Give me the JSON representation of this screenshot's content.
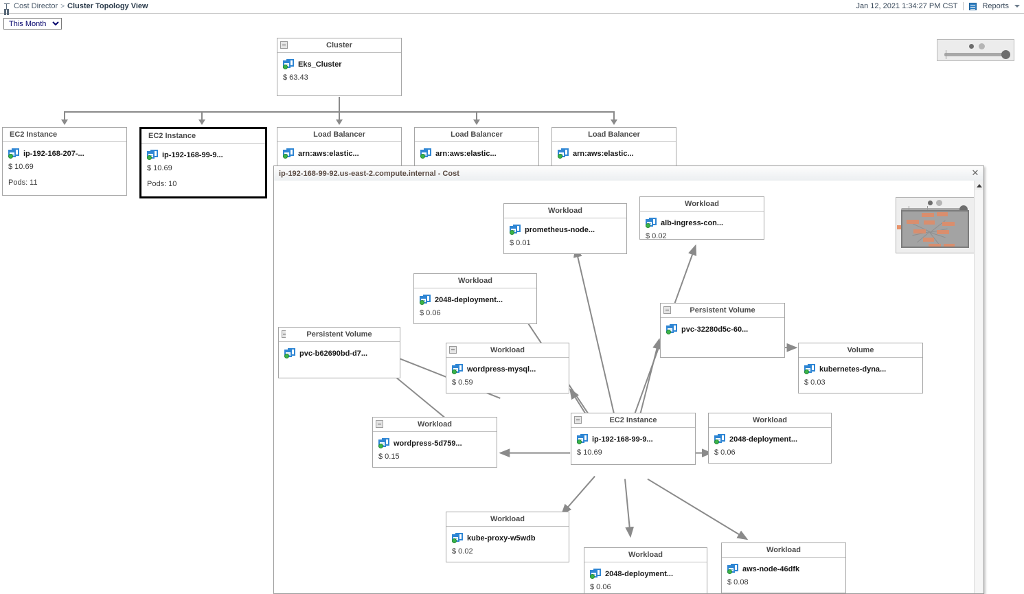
{
  "header": {
    "breadcrumb_root": "Cost Director",
    "breadcrumb_sep": ">",
    "breadcrumb_current": "Cluster Topology View",
    "timestamp": "Jan 12, 2021 1:34:27 PM CST",
    "reports_label": "Reports",
    "home_icon": "home-icon",
    "reports_icon": "reports-icon",
    "caret_icon": "chevron-down-icon"
  },
  "toolbar": {
    "period_selected": "This Month",
    "period_options": [
      "This Month"
    ]
  },
  "canvas": {
    "zoom_widget_name": "zoom-slider"
  },
  "topology": {
    "cluster": {
      "type_label": "Cluster",
      "name": "Eks_Cluster",
      "cost": "$ 63.43"
    },
    "children": [
      {
        "type_label": "EC2 Instance",
        "name": "ip-192-168-207-...",
        "cost": "$ 10.69",
        "pods": "Pods: 11",
        "selected": false,
        "title_align": "left"
      },
      {
        "type_label": "EC2 Instance",
        "name": "ip-192-168-99-9...",
        "cost": "$ 10.69",
        "pods": "Pods: 10",
        "selected": true,
        "title_align": "left"
      },
      {
        "type_label": "Load Balancer",
        "name": "arn:aws:elastic...",
        "cost": "",
        "pods": "",
        "selected": false,
        "title_align": "center"
      },
      {
        "type_label": "Load Balancer",
        "name": "arn:aws:elastic...",
        "cost": "",
        "pods": "",
        "selected": false,
        "title_align": "center"
      },
      {
        "type_label": "Load Balancer",
        "name": "arn:aws:elastic...",
        "cost": "",
        "pods": "",
        "selected": false,
        "title_align": "center"
      }
    ]
  },
  "popup": {
    "title": "ip-192-168-99-92.us-east-2.compute.internal - Cost",
    "close_label": "✕",
    "nodes": [
      {
        "id": "n-prometheus",
        "type_label": "Workload",
        "name": "prometheus-node...",
        "cost": "$ 0.01"
      },
      {
        "id": "n-alb",
        "type_label": "Workload",
        "name": "alb-ingress-con...",
        "cost": "$ 0.02"
      },
      {
        "id": "n-2048-a",
        "type_label": "Workload",
        "name": "2048-deployment...",
        "cost": "$ 0.06"
      },
      {
        "id": "n-pvc-32280",
        "type_label": "Persistent Volume",
        "name": "pvc-32280d5c-60...",
        "cost": ""
      },
      {
        "id": "n-volume",
        "type_label": "Volume",
        "name": "kubernetes-dyna...",
        "cost": "$ 0.03"
      },
      {
        "id": "n-pvc-b626",
        "type_label": "Persistent Volume",
        "name": "pvc-b62690bd-d7...",
        "cost": ""
      },
      {
        "id": "n-wp-mysql",
        "type_label": "Workload",
        "name": "wordpress-mysql...",
        "cost": "$ 0.59"
      },
      {
        "id": "n-wp-5d759",
        "type_label": "Workload",
        "name": "wordpress-5d759...",
        "cost": "$ 0.15"
      },
      {
        "id": "n-ec2-center",
        "type_label": "EC2 Instance",
        "name": "ip-192-168-99-9...",
        "cost": "$ 10.69"
      },
      {
        "id": "n-2048-b",
        "type_label": "Workload",
        "name": "2048-deployment...",
        "cost": "$ 0.06"
      },
      {
        "id": "n-kube-proxy",
        "type_label": "Workload",
        "name": "kube-proxy-w5wdb",
        "cost": "$ 0.02"
      },
      {
        "id": "n-2048-c",
        "type_label": "Workload",
        "name": "2048-deployment...",
        "cost": "$ 0.06"
      },
      {
        "id": "n-aws-node",
        "type_label": "Workload",
        "name": "aws-node-46dfk",
        "cost": "$ 0.08"
      }
    ],
    "minimap_name": "minimap",
    "scrollbar_name": "vertical-scrollbar"
  },
  "colors": {
    "accent_blue": "#2f86d4",
    "status_green": "#3ab54a",
    "edge_gray": "#8a8a8a",
    "selected_border": "#000000",
    "minimap_block": "#d98e6e"
  }
}
